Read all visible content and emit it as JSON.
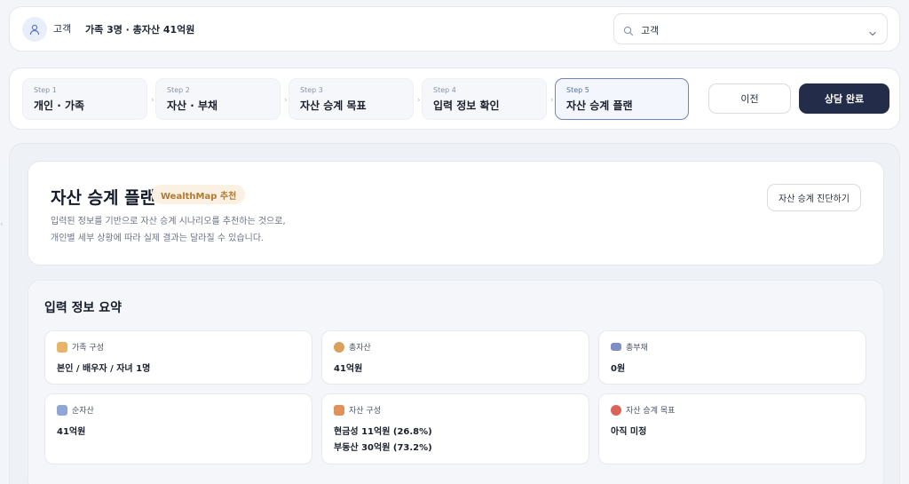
{
  "header": {
    "role": "고객",
    "family_summary": "가족 3명 · 총자산 41억원",
    "client_select": {
      "value": "고객"
    }
  },
  "steps": [
    {
      "num": "Step 1",
      "label": "개인 · 가족"
    },
    {
      "num": "Step 2",
      "label": "자산 · 부채"
    },
    {
      "num": "Step 3",
      "label": "자산 승계 목표"
    },
    {
      "num": "Step 4",
      "label": "입력 정보 확인"
    },
    {
      "num": "Step 5",
      "label": "자산 승계 플랜"
    }
  ],
  "active_step": 5,
  "nav": {
    "prev": "이전",
    "done": "상담 완료"
  },
  "plan": {
    "title": "자산 승계 플랜",
    "badge": "WealthMap 추천",
    "desc_line1": "입력된 정보를 기반으로 자산 승계 시나리오를 추천하는 것으로,",
    "desc_line2": "개인별 세부 상황에 따라 실제 결과는 달라질 수 있습니다.",
    "diagnose_button": "자산 승계 진단하기"
  },
  "summary": {
    "title": "입력 정보 요약",
    "tiles": [
      {
        "icon": "family-icon",
        "label": "가족 구성",
        "value": "본인 / 배우자 / 자녀 1명",
        "color": "#e8b36a"
      },
      {
        "icon": "money-bag-icon",
        "label": "총자산",
        "value": "41억원",
        "color": "#d9a15a"
      },
      {
        "icon": "card-icon",
        "label": "총부채",
        "value": "0원",
        "color": "#7d8fc4"
      },
      {
        "icon": "chart-icon",
        "label": "순자산",
        "value": "41억원",
        "color": "#8fa6d6"
      },
      {
        "icon": "house-icon",
        "label": "자산 구성",
        "value": "현금성 11억원 (26.8%)",
        "value2": "부동산 30억원 (73.2%)",
        "color": "#e0925a"
      },
      {
        "icon": "target-icon",
        "label": "자산 승계 목표",
        "value": "아직 미정",
        "color": "#d9645a"
      }
    ]
  },
  "colors": {
    "primary_dark": "#232d4a",
    "active_border": "#6f86b8",
    "badge_bg": "#fbf1e3",
    "badge_text": "#b07a34"
  }
}
